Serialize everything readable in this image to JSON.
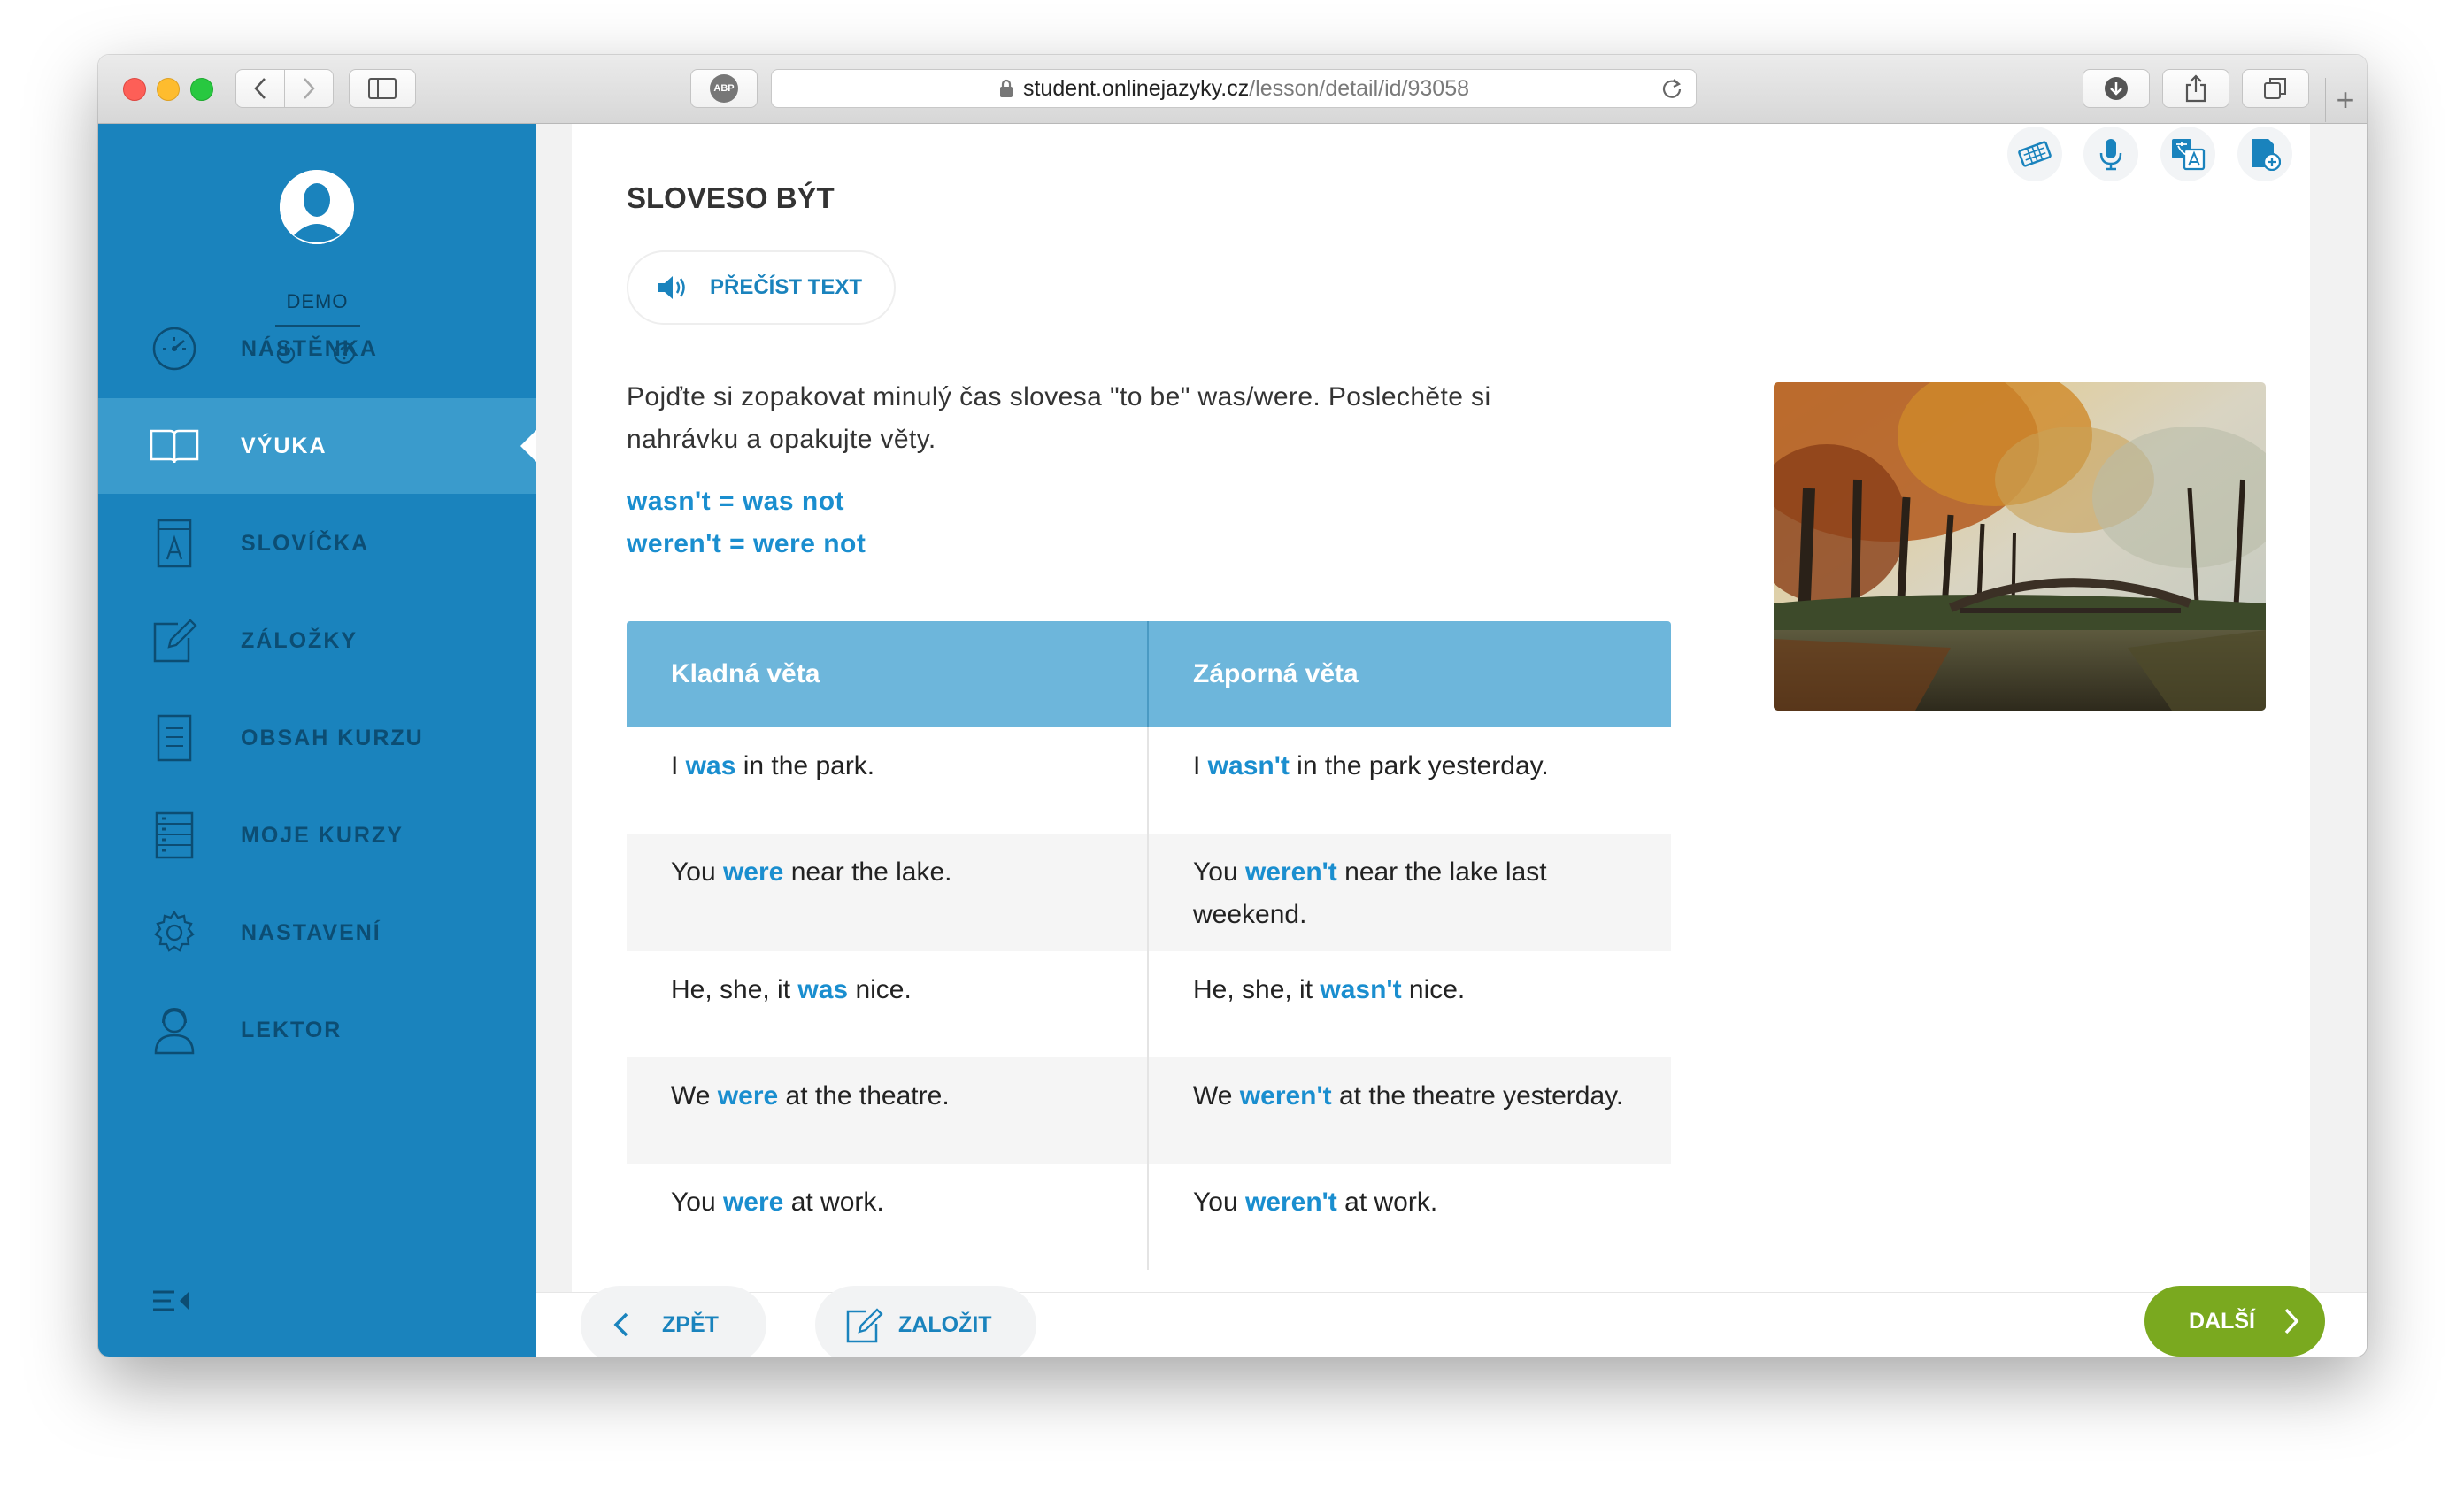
{
  "browser": {
    "url_domain": "student.onlinejazyky.cz",
    "url_path": "/lesson/detail/id/93058",
    "adblock_label": "ABP"
  },
  "sidebar": {
    "user_name": "DEMO",
    "items": [
      {
        "label": "NÁSTĚNKA",
        "icon": "dashboard-icon"
      },
      {
        "label": "VÝUKA",
        "icon": "book-icon",
        "active": true
      },
      {
        "label": "SLOVÍČKA",
        "icon": "vocabulary-icon"
      },
      {
        "label": "ZÁLOŽKY",
        "icon": "bookmark-edit-icon"
      },
      {
        "label": "OBSAH KURZU",
        "icon": "document-icon"
      },
      {
        "label": "MOJE KURZY",
        "icon": "course-list-icon"
      },
      {
        "label": "NASTAVENÍ",
        "icon": "gear-icon"
      },
      {
        "label": "LEKTOR",
        "icon": "tutor-icon"
      }
    ]
  },
  "lesson": {
    "title": "SLOVESO BÝT",
    "read_button": "PŘEČÍST TEXT",
    "intro": "Pojďte si zopakovat minulý čas slovesa \"to be\" was/were. Poslechěte si nahrávku a opakujte věty.",
    "definitions": [
      "wasn't  =  was not",
      "weren't  =  were not"
    ],
    "table": {
      "headers": [
        "Kladná věta",
        "Záporná věta"
      ],
      "rows": [
        {
          "pos": [
            "I ",
            "was",
            " in the park."
          ],
          "neg": [
            "I ",
            "wasn't",
            " in the park yesterday."
          ]
        },
        {
          "pos": [
            "You ",
            "were",
            " near the lake."
          ],
          "neg": [
            "You ",
            "weren't",
            " near the lake last weekend."
          ]
        },
        {
          "pos": [
            "He, she, it ",
            "was",
            " nice."
          ],
          "neg": [
            "He, she, it ",
            "wasn't",
            " nice."
          ]
        },
        {
          "pos": [
            "We ",
            "were",
            " at the theatre."
          ],
          "neg": [
            "We ",
            "weren't",
            " at the theatre yesterday."
          ]
        },
        {
          "pos": [
            "You ",
            "were",
            " at work."
          ],
          "neg": [
            "You ",
            "weren't",
            " at work."
          ]
        }
      ]
    }
  },
  "footer": {
    "back": "ZPĚT",
    "bookmark": "ZALOŽIT",
    "next": "DALŠÍ"
  },
  "colors": {
    "sidebar": "#1a83bd",
    "sidebar_active": "#3a9bcc",
    "accent": "#1a8ecf",
    "table_header": "#6db6db",
    "next_button": "#7aa91f"
  }
}
